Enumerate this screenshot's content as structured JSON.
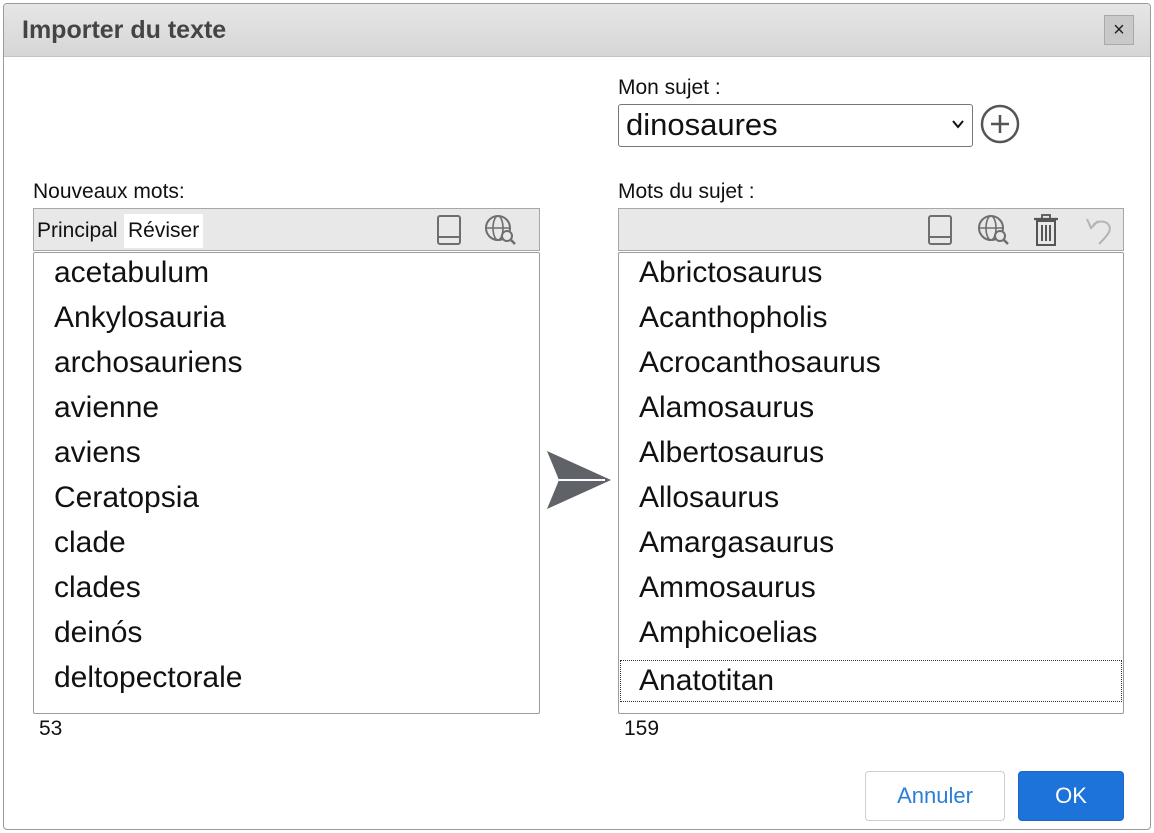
{
  "dialog": {
    "title": "Importer du texte",
    "close_label": "×"
  },
  "subject": {
    "label": "Mon sujet :",
    "selected": "dinosaures"
  },
  "left_panel": {
    "label": "Nouveaux mots:",
    "tabs": [
      "Principal",
      "Réviser"
    ],
    "active_tab": "Réviser",
    "icons": [
      "book-icon",
      "globe-search-icon"
    ],
    "words": [
      "acetabulum",
      "Ankylosauria",
      "archosauriens",
      "avienne",
      "aviens",
      "Ceratopsia",
      "clade",
      "clades",
      "deinós",
      "deltopectorale"
    ],
    "count": "53"
  },
  "right_panel": {
    "label": "Mots du sujet :",
    "icons": [
      "book-icon",
      "globe-search-icon",
      "trash-icon",
      "undo-icon"
    ],
    "words": [
      "Abrictosaurus",
      "Acanthopholis",
      "Acrocanthosaurus",
      "Alamosaurus",
      "Albertosaurus",
      "Allosaurus",
      "Amargasaurus",
      "Ammosaurus",
      "Amphicoelias",
      "Anatotitan"
    ],
    "count": "159"
  },
  "buttons": {
    "cancel": "Annuler",
    "ok": "OK"
  },
  "colors": {
    "accent": "#1d73d9",
    "icon": "#6e6e6e",
    "arrow": "#5f6266"
  }
}
